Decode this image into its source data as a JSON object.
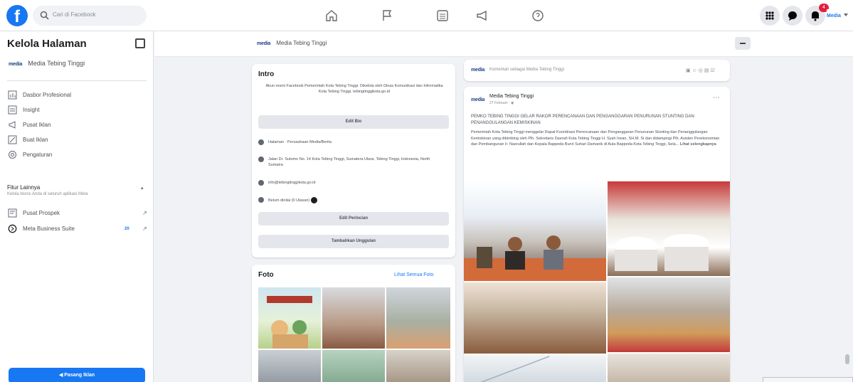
{
  "topbar": {
    "logo": "f",
    "search_placeholder": "Cari di Facebook",
    "nav_icons": [
      "home-icon",
      "flag-icon",
      "pages-icon",
      "megaphone-icon",
      "help-icon"
    ],
    "notification_count": "4",
    "account_brand": "Media"
  },
  "sidebar": {
    "title": "Kelola Halaman",
    "page_brand": "media",
    "page_name": "Media Tebing Tinggi",
    "items": [
      {
        "label": "Dasbor Profesional",
        "icon": "dashboard-icon"
      },
      {
        "label": "Insight",
        "icon": "insight-icon"
      },
      {
        "label": "Pusat Iklan",
        "icon": "ad-center-icon"
      },
      {
        "label": "Buat Iklan",
        "icon": "create-ad-icon"
      },
      {
        "label": "Pengaturan",
        "icon": "settings-icon"
      }
    ],
    "more_title": "Fitur Lainnya",
    "more_subtitle": "Kelola bisnis Anda di seluruh aplikasi Meta",
    "more_items": [
      {
        "label": "Pusat Prospek",
        "icon": "leads-icon"
      },
      {
        "label": "Meta Business Suite",
        "icon": "business-suite-icon",
        "badge": "20"
      }
    ],
    "promo_button": "Pasang Iklan"
  },
  "page_header": {
    "brand": "media",
    "name": "Media Tebing Tinggi"
  },
  "intro": {
    "title": "Intro",
    "description": "Akun resmi Facebook Pemerintah Kota Tebing Tinggi. Dikelola oleh Dinas Komunikasi dan Informatika Kota Tebing Tinggi. tebingtinggikota.go.id",
    "edit_bio": "Edit Bio",
    "rows": [
      {
        "icon": "info-icon",
        "text": "Halaman · Perusahaan Media/Berita"
      },
      {
        "icon": "location-icon",
        "text": "Jalan Dr. Sutomo No. 14 Kota Tebing Tinggi, Sumatera Utara, Tebing Tinggi, Indonesia, North Sumatra"
      },
      {
        "icon": "email-icon",
        "text": "info@tebingtinggikota.go.id"
      },
      {
        "icon": "rating-icon",
        "text": "Belum dinilai (0 Ulasan)"
      }
    ],
    "edit_details": "Edit Perincian",
    "add_featured": "Tambahkan Unggulan"
  },
  "photos": {
    "title": "Foto",
    "see_all": "Lihat Semua Foto"
  },
  "composer": {
    "brand": "media",
    "placeholder": "Komentari sebagai Media Tebing Tinggi"
  },
  "post": {
    "brand": "media",
    "author": "Media Tebing Tinggi",
    "time": "27 Februari · ",
    "headline": "PEMKO TEBING TINGGI GELAR RAKOR PERENCANAAN DAN PENGANGGARAN PENURUNAN STUNTING DAN PENANGGULANGAN KEMISKINAN",
    "body": "Pemerintah Kota Tebing Tinggi menggelar Rapat Koordinasi Perencanaan dan Penganggaran Penurunan Stunting dan Penanggulangan Kemiskinan yang dibimbing oleh Plh. Sekretaris Daerah Kota Tebing Tinggi H. Syah Irwan, SH.M. Si dan didampingi Plh. Asisten Perekonomian dan Pembangunan Ir. Nasrullah dan Kepala Bappeda Bunri Suhari Damanik di Aula Bappeda Kota Tebing Tinggi, Sela...",
    "more": "Lihat selengkapnya"
  }
}
